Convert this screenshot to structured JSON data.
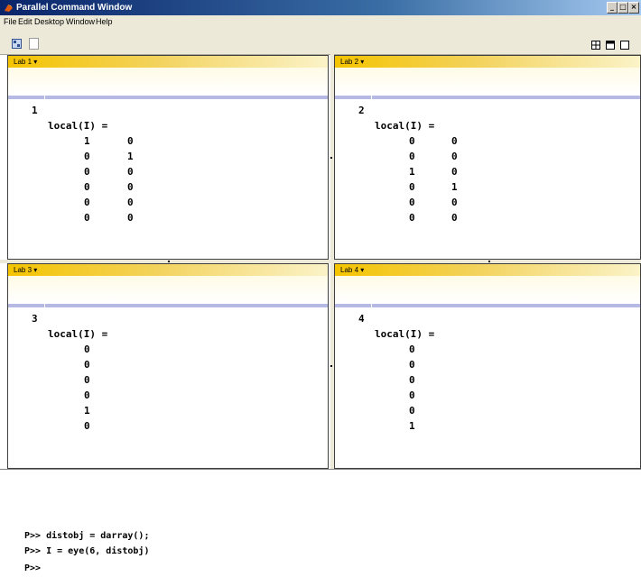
{
  "window": {
    "title": "Parallel Command Window",
    "controls": [
      "_",
      "□",
      "×"
    ]
  },
  "menubar": {
    "items": [
      "File",
      "Edit",
      "Desktop",
      "Window",
      "Help"
    ]
  },
  "toolbar": {
    "left_icons": [
      "parallel-window-icon",
      "new-document-icon"
    ],
    "right_icons": [
      "grid-layout-icon",
      "tile-icon",
      "single-window-icon"
    ]
  },
  "labs": [
    {
      "title": "Lab 1 ▾",
      "index": "1",
      "var": "local(I) =",
      "rows": [
        [
          "1",
          "0"
        ],
        [
          "0",
          "1"
        ],
        [
          "0",
          "0"
        ],
        [
          "0",
          "0"
        ],
        [
          "0",
          "0"
        ],
        [
          "0",
          "0"
        ]
      ]
    },
    {
      "title": "Lab 2 ▾",
      "index": "2",
      "var": "local(I) =",
      "rows": [
        [
          "0",
          "0"
        ],
        [
          "0",
          "0"
        ],
        [
          "1",
          "0"
        ],
        [
          "0",
          "1"
        ],
        [
          "0",
          "0"
        ],
        [
          "0",
          "0"
        ]
      ]
    },
    {
      "title": "Lab 3 ▾",
      "index": "3",
      "var": "local(I) =",
      "rows": [
        [
          "0"
        ],
        [
          "0"
        ],
        [
          "0"
        ],
        [
          "0"
        ],
        [
          "1"
        ],
        [
          "0"
        ]
      ]
    },
    {
      "title": "Lab 4 ▾",
      "index": "4",
      "var": "local(I) =",
      "rows": [
        [
          "0"
        ],
        [
          "0"
        ],
        [
          "0"
        ],
        [
          "0"
        ],
        [
          "0"
        ],
        [
          "1"
        ]
      ]
    }
  ],
  "command": {
    "lines": [
      "P>> distobj = darray();",
      "P>> I = eye(6, distobj)",
      "P>>"
    ]
  },
  "colors": {
    "lab_header": "#f5c400",
    "separator_bar": "#b5b9e3",
    "titlebar": "#0a246a"
  }
}
